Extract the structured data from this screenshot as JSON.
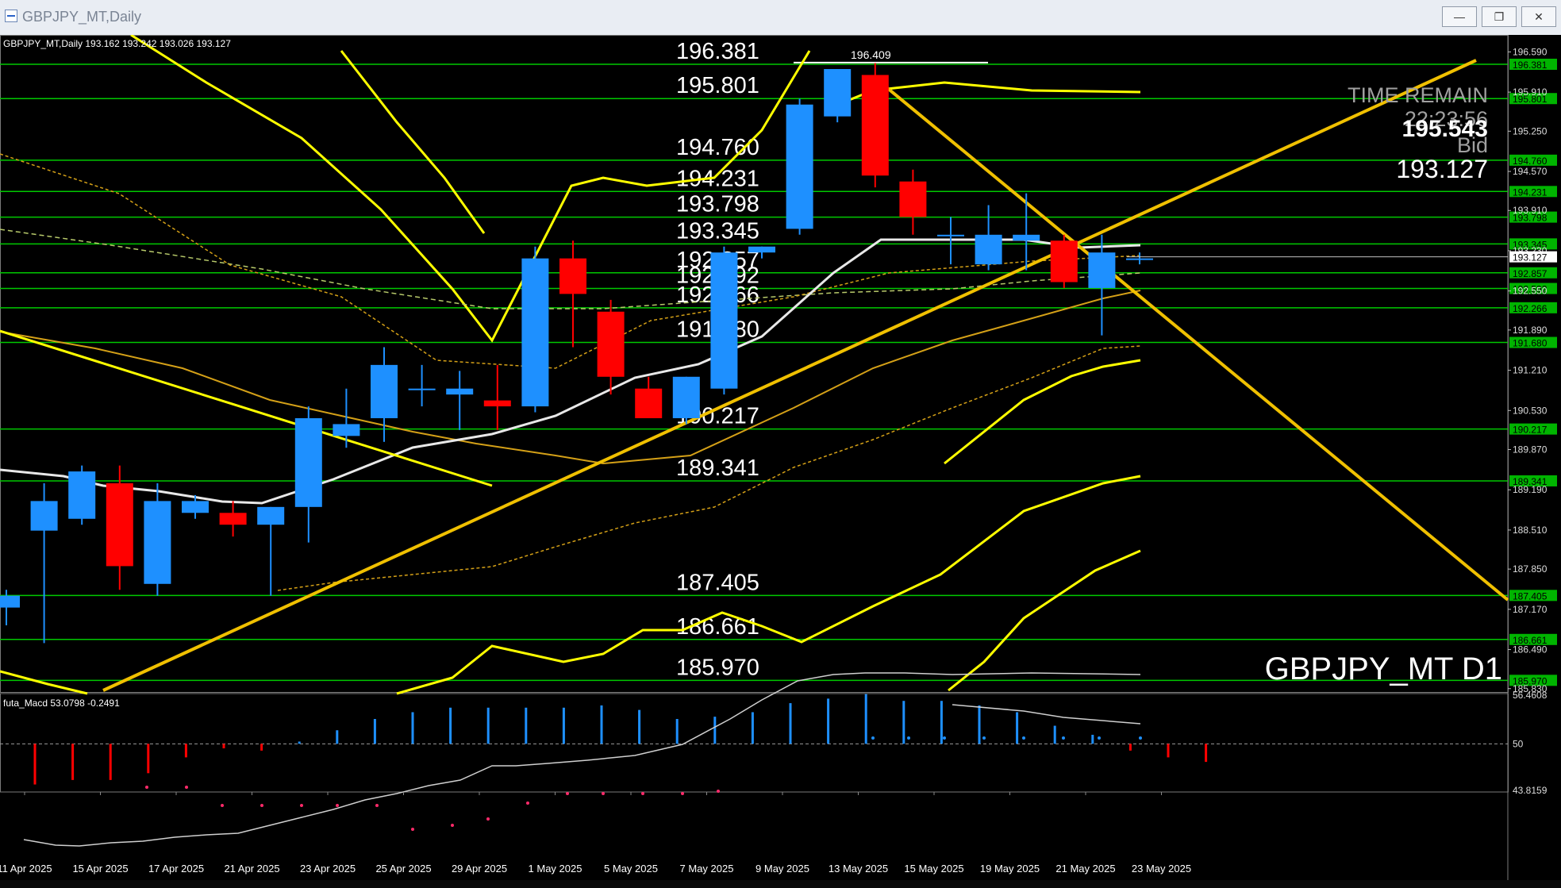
{
  "window": {
    "title": "GBPJPY_MT,Daily",
    "buttons": [
      "minimize",
      "restore",
      "close"
    ]
  },
  "header": {
    "symbol_info": "GBPJPY_MT,Daily  193.162 193.242 193.026 193.127"
  },
  "overlay": {
    "time_remain_label": "TIME REMAIN",
    "time_remain_value": "22:23:56",
    "big_price": "195.543",
    "bid_label": "Bid",
    "bid_value": "193.127",
    "symbol_big": "GBPJPY_MT D1",
    "peak_label": "196.409"
  },
  "colors": {
    "bull": "#1e90ff",
    "bear": "#ff0000",
    "level": "#00c800",
    "trend": "#f0c000",
    "band": "#ffff00",
    "ma_white": "#e8e8e8",
    "ma_orange": "#d4a017"
  },
  "chart_data": [
    {
      "type": "candlestick",
      "title": "GBPJPY_MT,Daily",
      "y_axis_ticks": [
        "196.590",
        "195.910",
        "195.250",
        "194.570",
        "193.910",
        "193.230",
        "192.550",
        "191.890",
        "191.210",
        "190.530",
        "189.870",
        "189.190",
        "188.510",
        "187.850",
        "187.170",
        "186.490",
        "185.830"
      ],
      "ylim": [
        185.8,
        196.85
      ],
      "levels": [
        "196.381",
        "195.801",
        "194.760",
        "194.231",
        "193.798",
        "193.345",
        "192.857",
        "192.592",
        "192.266",
        "191.680",
        "190.217",
        "189.341",
        "187.405",
        "186.661",
        "185.970"
      ],
      "current_price": "193.127",
      "x_labels": [
        "11 Apr 2025",
        "15 Apr 2025",
        "17 Apr 2025",
        "21 Apr 2025",
        "23 Apr 2025",
        "25 Apr 2025",
        "29 Apr 2025",
        "1 May 2025",
        "5 May 2025",
        "7 May 2025",
        "9 May 2025",
        "13 May 2025",
        "15 May 2025",
        "19 May 2025",
        "21 May 2025",
        "23 May 2025"
      ],
      "candles": [
        {
          "o": 187.2,
          "h": 187.5,
          "l": 186.9,
          "c": 187.4
        },
        {
          "o": 188.5,
          "h": 189.3,
          "l": 186.6,
          "c": 189.0
        },
        {
          "o": 188.7,
          "h": 189.6,
          "l": 188.6,
          "c": 189.5
        },
        {
          "o": 189.3,
          "h": 189.6,
          "l": 187.5,
          "c": 187.9
        },
        {
          "o": 187.6,
          "h": 189.3,
          "l": 187.4,
          "c": 189.0
        },
        {
          "o": 188.8,
          "h": 189.1,
          "l": 188.7,
          "c": 189.0
        },
        {
          "o": 188.8,
          "h": 189.0,
          "l": 188.4,
          "c": 188.6
        },
        {
          "o": 188.6,
          "h": 188.9,
          "l": 187.4,
          "c": 188.9
        },
        {
          "o": 188.9,
          "h": 190.6,
          "l": 188.3,
          "c": 190.4
        },
        {
          "o": 190.1,
          "h": 190.9,
          "l": 189.9,
          "c": 190.3
        },
        {
          "o": 190.4,
          "h": 191.6,
          "l": 190.0,
          "c": 191.3
        },
        {
          "o": 190.9,
          "h": 191.3,
          "l": 190.6,
          "c": 190.9
        },
        {
          "o": 190.8,
          "h": 191.2,
          "l": 190.2,
          "c": 190.9
        },
        {
          "o": 190.7,
          "h": 191.3,
          "l": 190.2,
          "c": 190.6
        },
        {
          "o": 190.6,
          "h": 193.3,
          "l": 190.5,
          "c": 193.1
        },
        {
          "o": 193.1,
          "h": 193.4,
          "l": 191.6,
          "c": 192.5
        },
        {
          "o": 192.2,
          "h": 192.4,
          "l": 190.8,
          "c": 191.1
        },
        {
          "o": 190.9,
          "h": 191.1,
          "l": 190.4,
          "c": 190.4
        },
        {
          "o": 190.4,
          "h": 191.1,
          "l": 190.3,
          "c": 191.1
        },
        {
          "o": 190.9,
          "h": 193.3,
          "l": 190.8,
          "c": 193.2
        },
        {
          "o": 193.2,
          "h": 193.3,
          "l": 193.1,
          "c": 193.3
        },
        {
          "o": 193.6,
          "h": 195.8,
          "l": 193.5,
          "c": 195.7
        },
        {
          "o": 195.5,
          "h": 196.3,
          "l": 195.4,
          "c": 196.3
        },
        {
          "o": 196.2,
          "h": 196.4,
          "l": 194.3,
          "c": 194.5
        },
        {
          "o": 194.4,
          "h": 194.6,
          "l": 193.5,
          "c": 193.8
        },
        {
          "o": 193.5,
          "h": 193.8,
          "l": 193.0,
          "c": 193.5
        },
        {
          "o": 193.0,
          "h": 194.0,
          "l": 192.9,
          "c": 193.5
        },
        {
          "o": 193.4,
          "h": 194.2,
          "l": 192.9,
          "c": 193.5
        },
        {
          "o": 193.4,
          "h": 193.5,
          "l": 192.6,
          "c": 192.7
        },
        {
          "o": 192.6,
          "h": 193.5,
          "l": 191.8,
          "c": 193.2
        },
        {
          "o": 193.1,
          "h": 193.2,
          "l": 193.0,
          "c": 193.1
        }
      ]
    },
    {
      "type": "histogram",
      "title": "futa_Macd 53.0798  -0.2491",
      "y_axis_ticks": [
        "56.4608",
        "50",
        "43.8159"
      ],
      "zero_line": "50"
    }
  ]
}
